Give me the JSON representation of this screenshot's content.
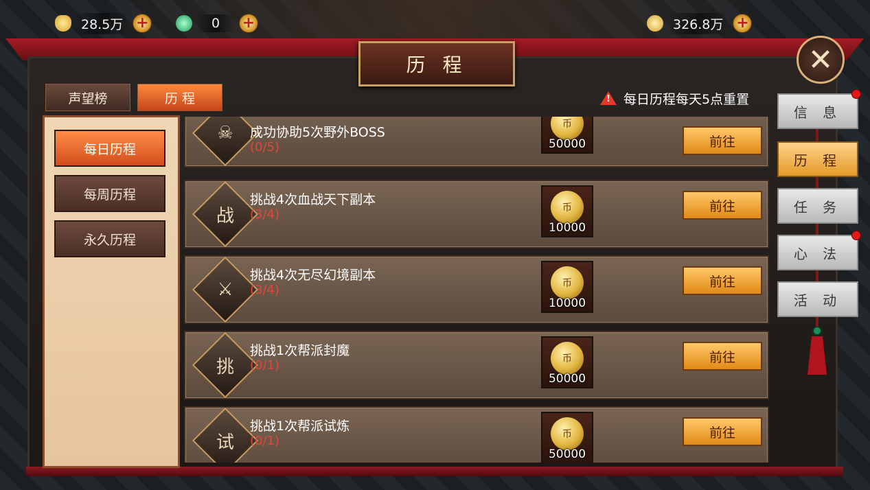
{
  "currency": {
    "gold_ingot": {
      "value": "28.5万",
      "icon": "gold-ingot-icon"
    },
    "jade": {
      "value": "0",
      "icon": "jade-icon"
    },
    "coin": {
      "value": "326.8万",
      "icon": "coin-icon"
    }
  },
  "window": {
    "title": "历 程"
  },
  "header_tabs": [
    {
      "label": "声望榜",
      "active": false
    },
    {
      "label": "历 程",
      "active": true
    }
  ],
  "notice": "每日历程每天5点重置",
  "sub_tabs": [
    {
      "label": "每日历程",
      "active": true
    },
    {
      "label": "每周历程",
      "active": false
    },
    {
      "label": "永久历程",
      "active": false
    }
  ],
  "tasks": [
    {
      "title": "成功协助5次野外BOSS",
      "progress": "(0/5)",
      "reward": "50000",
      "button": "前往",
      "icon": "skull-icon",
      "glyph": "☠"
    },
    {
      "title": "挑战4次血战天下副本",
      "progress": "(3/4)",
      "reward": "10000",
      "button": "前往",
      "icon": "scroll-icon",
      "glyph": "战"
    },
    {
      "title": "挑战4次无尽幻境副本",
      "progress": "(3/4)",
      "reward": "10000",
      "button": "前往",
      "icon": "sword-icon",
      "glyph": "⚔"
    },
    {
      "title": "挑战1次帮派封魔",
      "progress": "(0/1)",
      "reward": "50000",
      "button": "前往",
      "icon": "challenge-scroll-icon",
      "glyph": "挑"
    },
    {
      "title": "挑战1次帮派试炼",
      "progress": "(0/1)",
      "reward": "50000",
      "button": "前往",
      "icon": "trial-scroll-icon",
      "glyph": "试"
    }
  ],
  "side_tabs": [
    {
      "label": "信 息",
      "active": false,
      "badge": true
    },
    {
      "label": "历 程",
      "active": true,
      "badge": false
    },
    {
      "label": "任 务",
      "active": false,
      "badge": false
    },
    {
      "label": "心 法",
      "active": false,
      "badge": true
    },
    {
      "label": "活 动",
      "active": false,
      "badge": false
    }
  ],
  "colors": {
    "accent": "#e08a16",
    "progress_red": "#e0473a",
    "badge_red": "#e31818"
  }
}
